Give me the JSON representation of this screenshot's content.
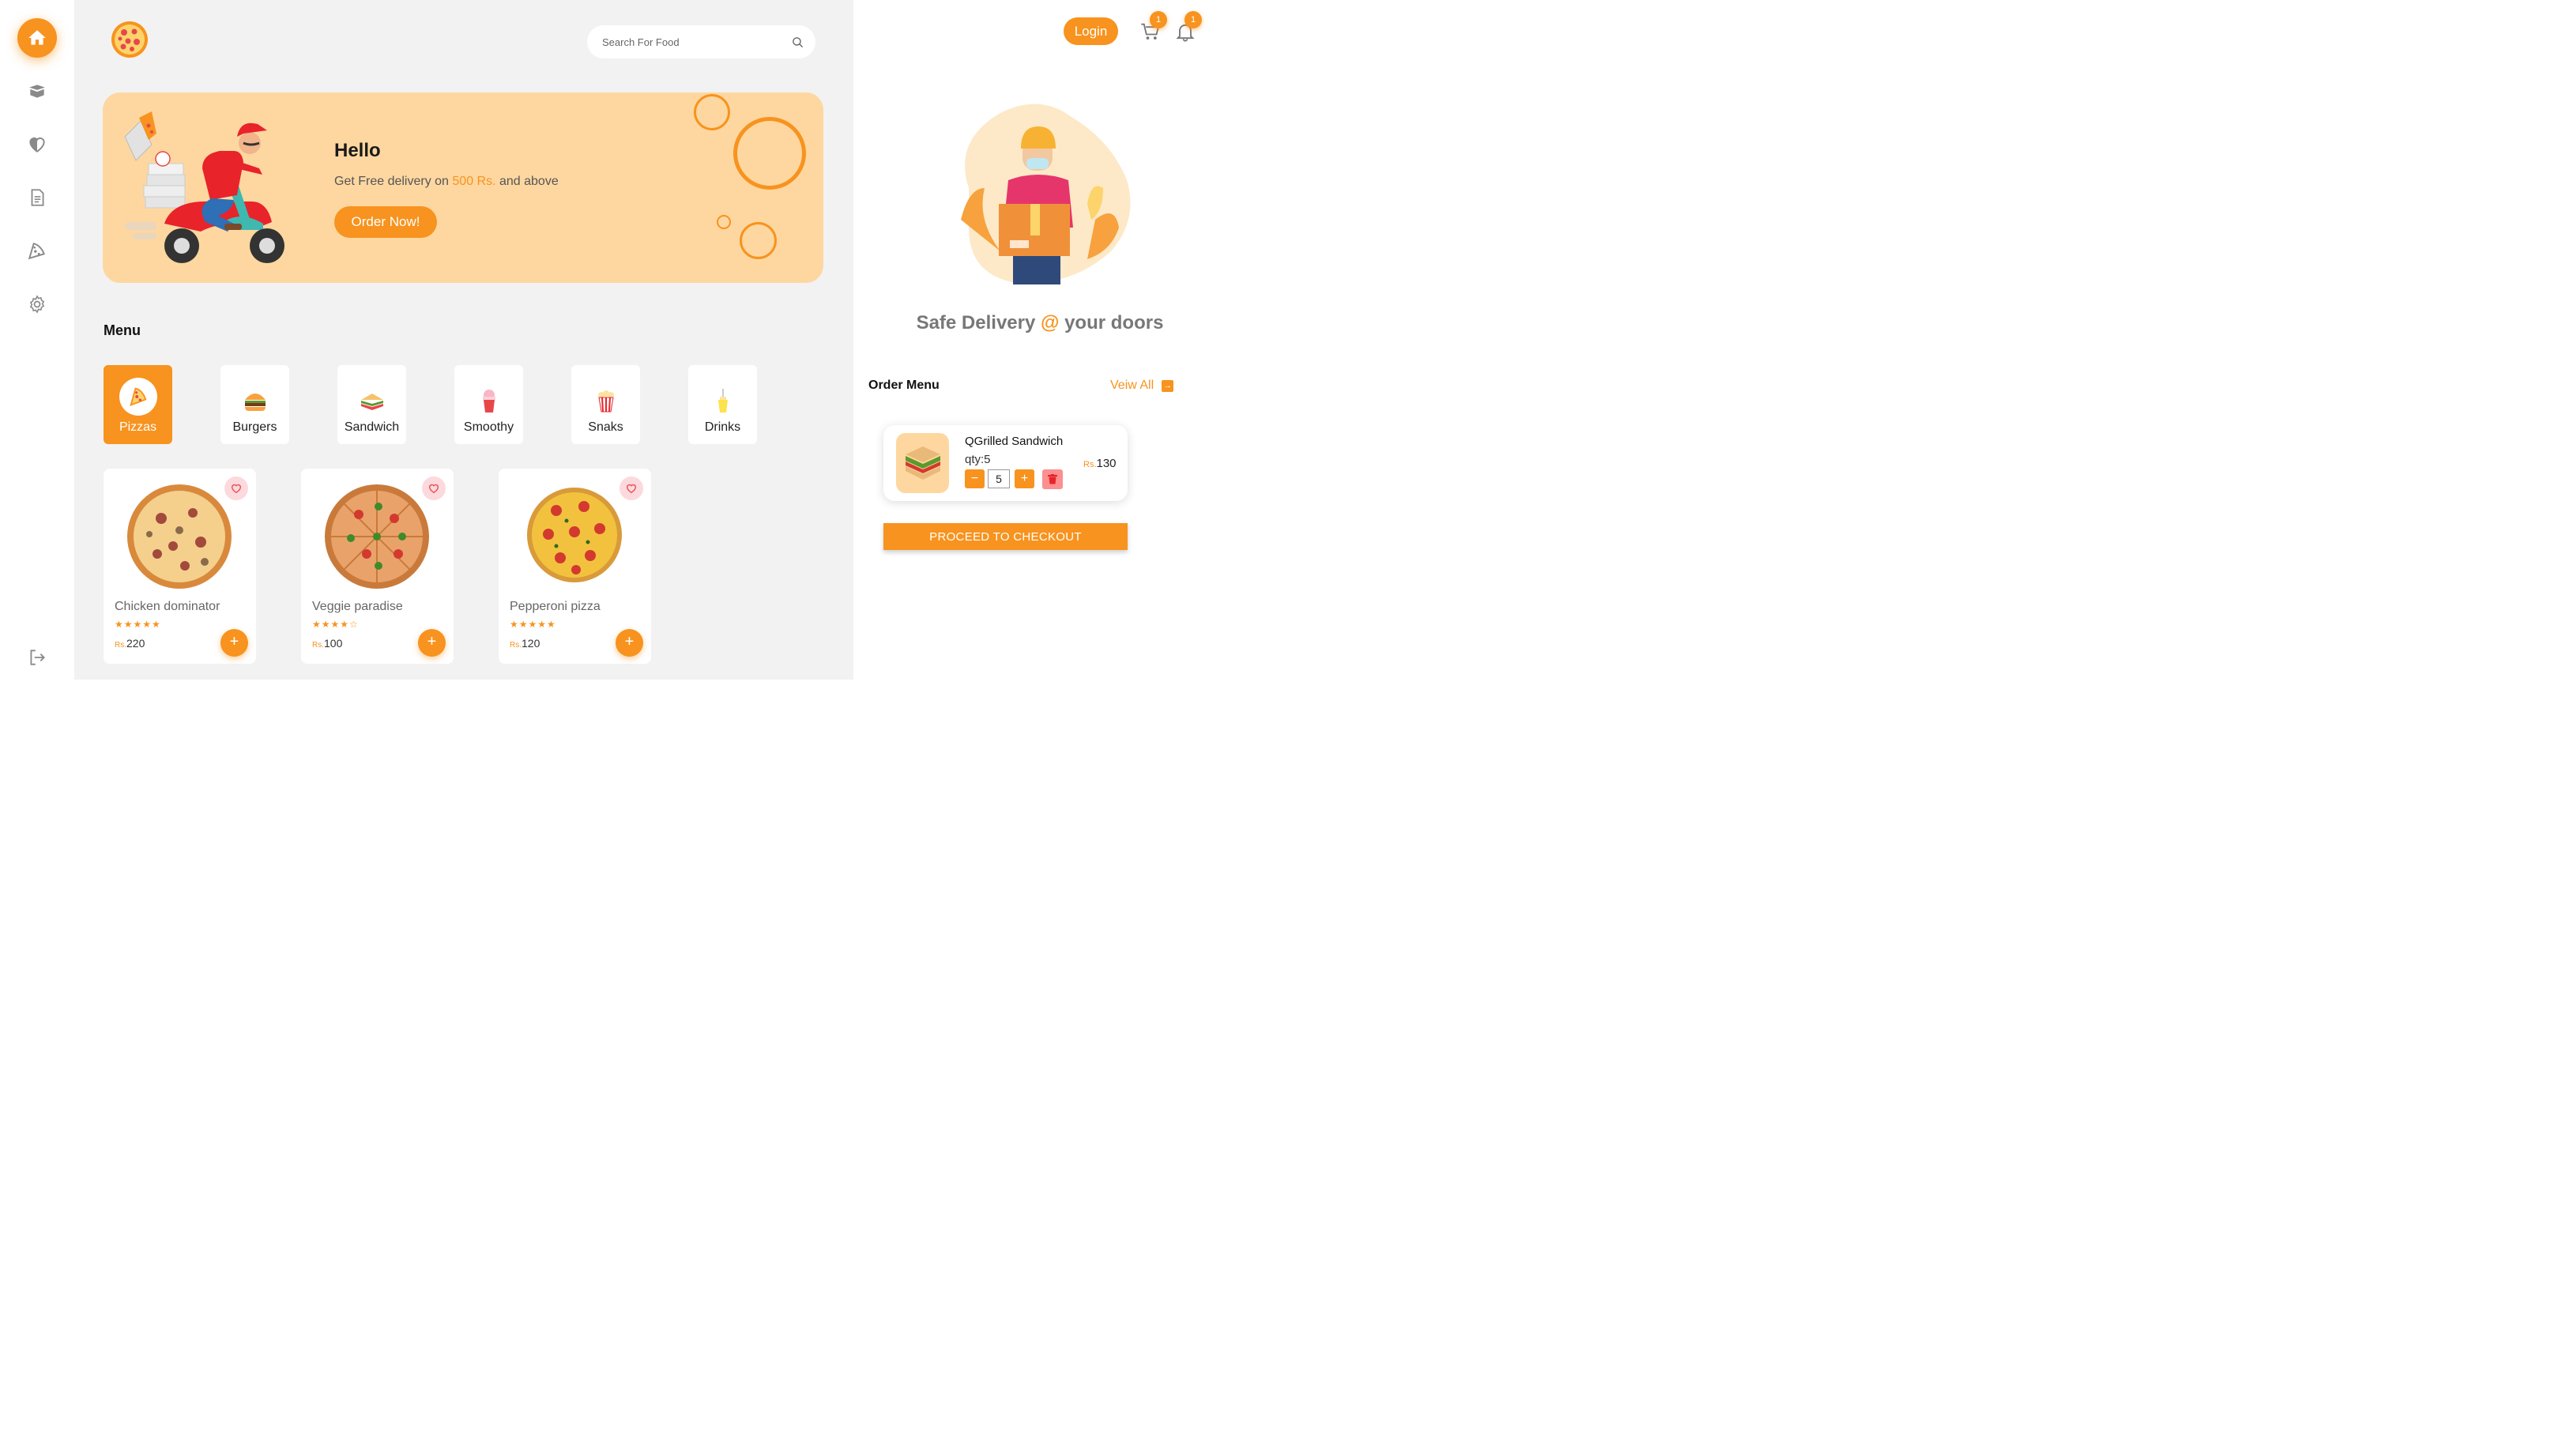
{
  "sidebar": {
    "items": [
      {
        "icon": "home-icon",
        "active": true
      },
      {
        "icon": "box-icon",
        "active": false
      },
      {
        "icon": "heart-icon",
        "active": false
      },
      {
        "icon": "document-icon",
        "active": false
      },
      {
        "icon": "pizza-slice-icon",
        "active": false
      },
      {
        "icon": "gear-icon",
        "active": false
      }
    ],
    "logout_icon": "logout-icon"
  },
  "search": {
    "placeholder": "Search For Food"
  },
  "hero": {
    "title": "Hello",
    "sub_before": "Get Free delivery on ",
    "sub_highlight": "500 Rs.",
    "sub_after": " and above",
    "button": "Order Now!"
  },
  "menu": {
    "title": "Menu",
    "categories": [
      {
        "label": "Pizzas",
        "icon": "pizza-icon",
        "active": true
      },
      {
        "label": "Burgers",
        "icon": "burger-icon",
        "active": false
      },
      {
        "label": "Sandwich",
        "icon": "sandwich-icon",
        "active": false
      },
      {
        "label": "Smoothy",
        "icon": "smoothy-icon",
        "active": false
      },
      {
        "label": "Snaks",
        "icon": "popcorn-icon",
        "active": false
      },
      {
        "label": "Drinks",
        "icon": "drink-icon",
        "active": false
      }
    ]
  },
  "products": [
    {
      "name": "Chicken dominator",
      "rating": 5,
      "currency": "Rs.",
      "price": "220"
    },
    {
      "name": "Veggie paradise",
      "rating": 4,
      "currency": "Rs.",
      "price": "100"
    },
    {
      "name": "Pepperoni pizza",
      "rating": 5,
      "currency": "Rs.",
      "price": "120"
    }
  ],
  "header": {
    "login": "Login",
    "cart_count": "1",
    "notification_count": "1"
  },
  "promo": {
    "tagline_before": "Safe Delivery ",
    "tagline_at": "@",
    "tagline_after": " your doors"
  },
  "order": {
    "title": "Order Menu",
    "view_all": "Veiw All",
    "item": {
      "name": "QGrilled Sandwich",
      "qty_label": "qty:5",
      "qty_value": "5",
      "currency": "Rs.",
      "price": "130"
    },
    "checkout": "PROCEED TO CHECKOUT"
  },
  "colors": {
    "accent": "#f7931e",
    "banner": "#fed7a0",
    "main_bg": "#f2f2f2"
  }
}
